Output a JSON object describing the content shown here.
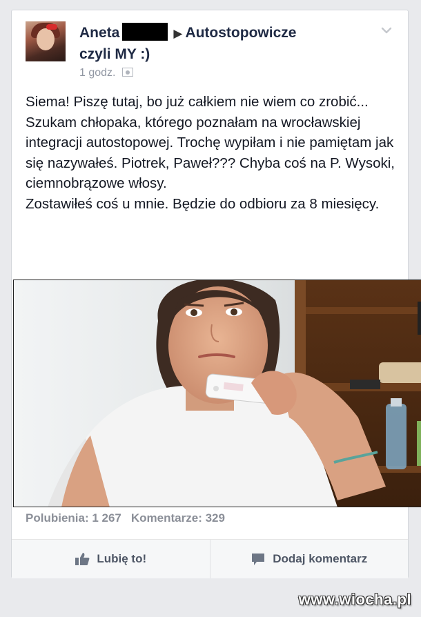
{
  "post": {
    "author_first": "Aneta",
    "group_arrow": "▶",
    "group_name": "Autostopowicze",
    "group_name_line2": "czyli MY :)",
    "time": "1 godz.",
    "audience_icon": "audience-icon",
    "text": "Siema! Piszę tutaj, bo już całkiem nie wiem co zrobić... Szukam chłopaka, którego poznałam na wrocławskiej integracji autostopowej. Trochę wypiłam i nie pamiętam jak się nazywałeś. Piotrek, Paweł??? Chyba coś na P. Wysoki, ciemnobrązowe włosy.\nZostawiłeś coś u mnie. Będzie do odbioru za 8 miesięcy."
  },
  "stats": {
    "likes_label": "Polubienia: 1 267",
    "comments_label": "Komentarze: 329"
  },
  "actions": {
    "like_label": "Lubię to!",
    "comment_label": "Dodaj komentarz"
  },
  "watermark": "www.wiocha.pl",
  "colors": {
    "background": "#e9eaed",
    "card": "#ffffff",
    "author": "#1f2a44",
    "meta": "#9197a3",
    "stats": "#8b8f98"
  }
}
